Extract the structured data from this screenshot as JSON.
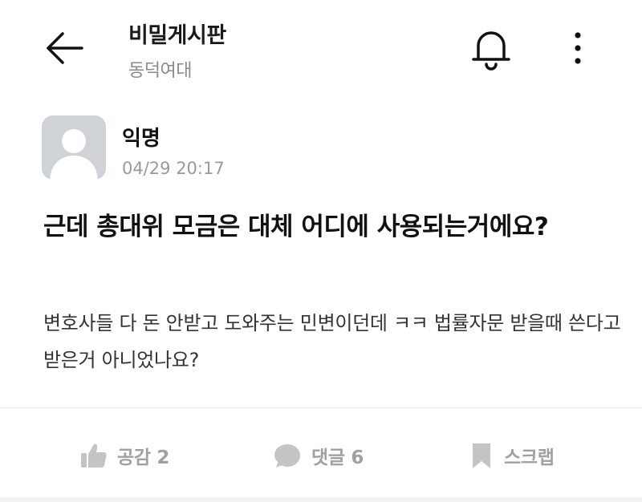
{
  "header": {
    "title": "비밀게시판",
    "subtitle": "동덕여대",
    "icons": {
      "back": "arrow-left-icon",
      "notification": "bell-icon",
      "more": "more-vertical-icon"
    }
  },
  "post": {
    "author": "익명",
    "time": "04/29 20:17",
    "title": "근데 총대위 모금은 대체 어디에 사용되는거에요?",
    "body": "변호사들 다 돈 안받고 도와주는 민변이던데 ㅋㅋ 법률자문 받을때 쓴다고 받은거 아니었나요?"
  },
  "actions": {
    "like_label": "공감 2",
    "comment_label": "댓글 6",
    "scrap_label": "스크랩"
  },
  "colors": {
    "icon_gray": "#c4c4c4",
    "text_gray": "#a0a0a0",
    "avatar_bg": "#cfd3d8"
  }
}
